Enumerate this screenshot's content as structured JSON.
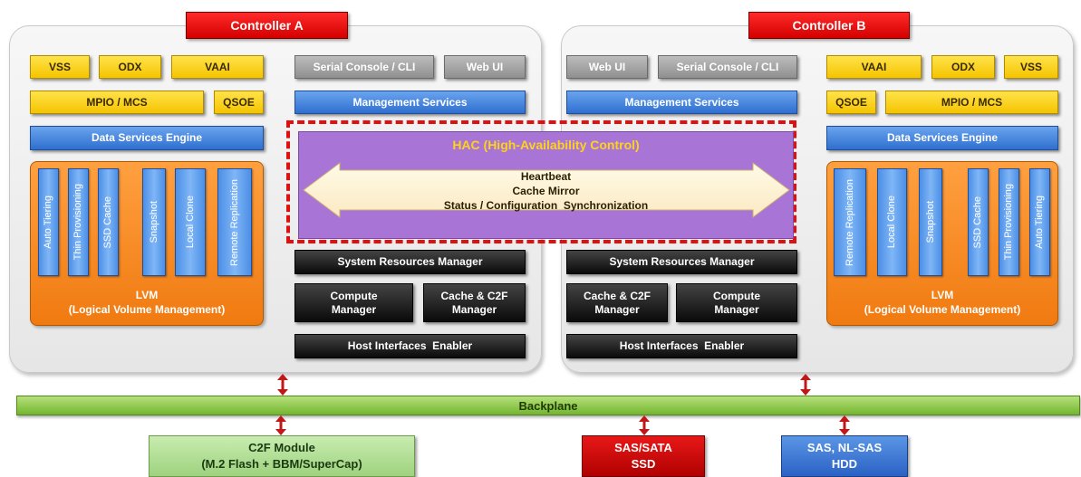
{
  "controller_a": {
    "title": "Controller A",
    "vss": "VSS",
    "odx": "ODX",
    "vaai": "VAAI",
    "mpio": "MPIO / MCS",
    "qsoe": "QSOE",
    "data_services": "Data Services Engine",
    "features": [
      "Auto Tiering",
      "Thin Provisioning",
      "SSD Cache",
      "Snapshot",
      "Local Clone",
      "Remote Replication"
    ],
    "lvm_line1": "LVM",
    "lvm_line2": "(Logical Volume Management)",
    "serial_console": "Serial Console / CLI",
    "web_ui": "Web UI",
    "management_services": "Management Services",
    "system_resources": "System Resources Manager",
    "compute_l1": "Compute",
    "compute_l2": "Manager",
    "cache_l1": "Cache & C2F",
    "cache_l2": "Manager",
    "host_interfaces": "Host Interfaces  Enabler"
  },
  "controller_b": {
    "title": "Controller B",
    "vss": "VSS",
    "odx": "ODX",
    "vaai": "VAAI",
    "mpio": "MPIO / MCS",
    "qsoe": "QSOE",
    "data_services": "Data Services Engine",
    "features": [
      "Remote Replication",
      "Local Clone",
      "Snapshot",
      "SSD Cache",
      "Thin Provisioning",
      "Auto Tiering"
    ],
    "lvm_line1": "LVM",
    "lvm_line2": "(Logical Volume Management)",
    "serial_console": "Serial Console / CLI",
    "web_ui": "Web UI",
    "management_services": "Management Services",
    "system_resources": "System Resources Manager",
    "compute_l1": "Compute",
    "compute_l2": "Manager",
    "cache_l1": "Cache & C2F",
    "cache_l2": "Manager",
    "host_interfaces": "Host Interfaces  Enabler"
  },
  "hac": {
    "title": "HAC (High-Availability Control)",
    "line1": "Heartbeat",
    "line2": "Cache Mirror",
    "line3": "Status / Configuration  Synchronization"
  },
  "backplane": "Backplane",
  "storage": {
    "c2f_l1": "C2F Module",
    "c2f_l2": "(M.2 Flash + BBM/SuperCap)",
    "ssd_l1": "SAS/SATA",
    "ssd_l2": "SSD",
    "hdd_l1": "SAS, NL-SAS",
    "hdd_l2": "HDD"
  },
  "colors": {
    "controller_title": "#e00000",
    "feature_yellow": "#f5c400",
    "service_blue": "#2f6fd0",
    "lvm_orange": "#f07a10",
    "hac_purple": "#a874d6",
    "backplane_green": "#74b530",
    "c2f_green": "#9ed27e",
    "ssd_red": "#b00000",
    "hdd_blue": "#2a62c4"
  }
}
